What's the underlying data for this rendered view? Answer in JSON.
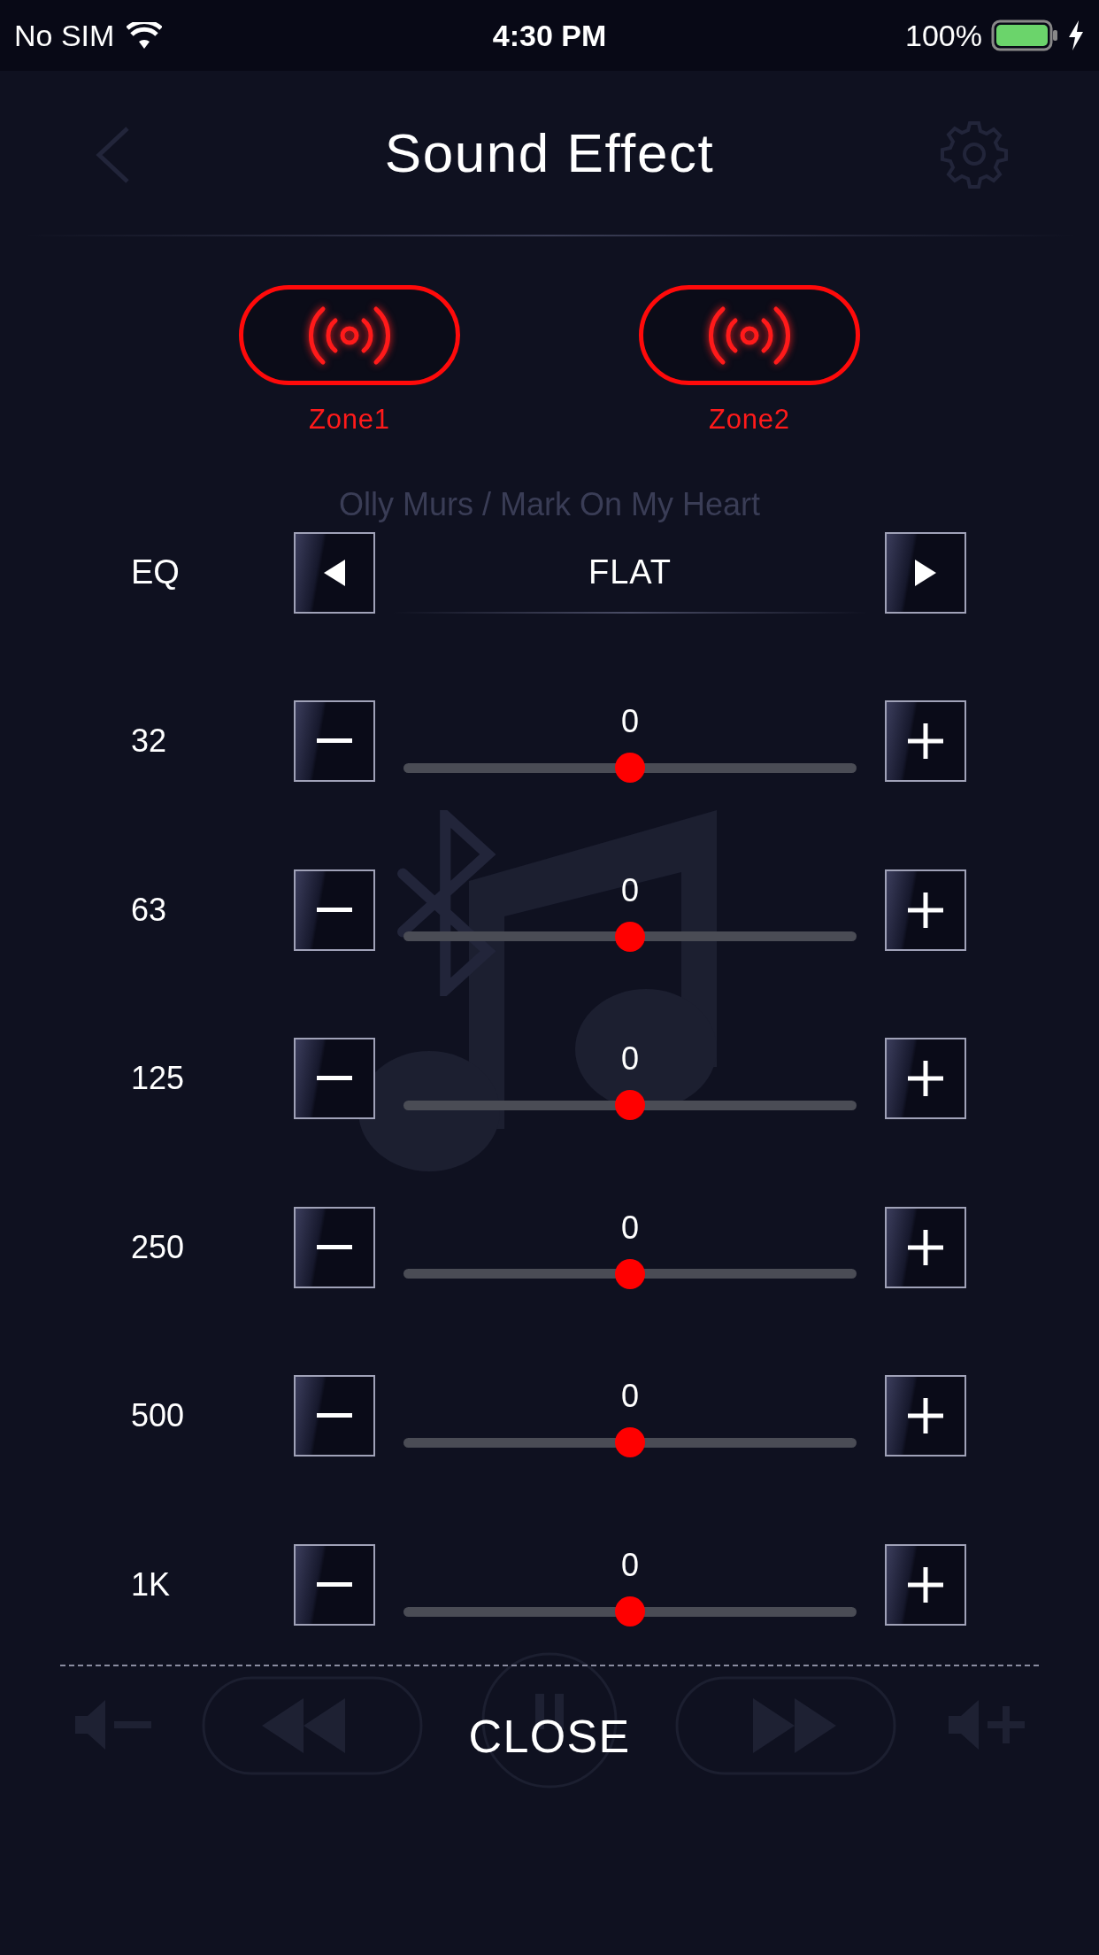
{
  "status_bar": {
    "carrier": "No SIM",
    "time": "4:30 PM",
    "battery": "100%"
  },
  "background": {
    "subtitle": "Olly Murs / Mark On My Heart"
  },
  "dialog": {
    "title": "Sound Effect",
    "zones": [
      {
        "label": "Zone1"
      },
      {
        "label": "Zone2"
      }
    ],
    "eq": {
      "label": "EQ",
      "preset": "FLAT"
    },
    "bands": [
      {
        "label": "32",
        "value": "0",
        "level": 0.5
      },
      {
        "label": "63",
        "value": "0",
        "level": 0.5
      },
      {
        "label": "125",
        "value": "0",
        "level": 0.5
      },
      {
        "label": "250",
        "value": "0",
        "level": 0.5
      },
      {
        "label": "500",
        "value": "0",
        "level": 0.5
      },
      {
        "label": "1K",
        "value": "0",
        "level": 0.5
      }
    ],
    "close": "CLOSE"
  }
}
